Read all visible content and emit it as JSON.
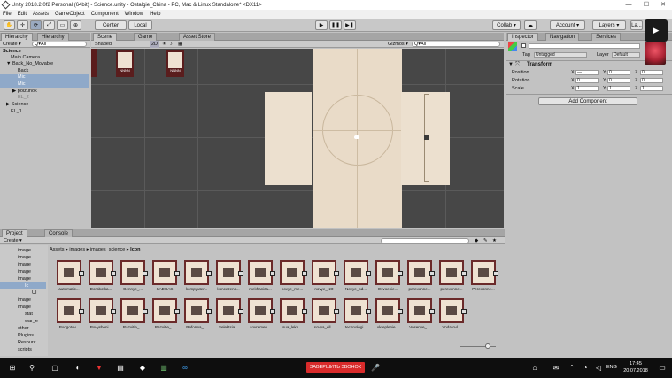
{
  "window": {
    "title": "Unity 2018.2.0f2 Personal (64bit) - Science.unity - Ostalgie_China - PC, Mac & Linux Standalone* <DX11>",
    "min": "—",
    "max": "☐",
    "close": "✕"
  },
  "menu": [
    "File",
    "Edit",
    "Assets",
    "GameObject",
    "Component",
    "Window",
    "Help"
  ],
  "toolbar": {
    "center": "Center",
    "local": "Local",
    "collab": "Collab ▾",
    "account": "Account ▾",
    "layers": "Layers ▾",
    "layout": "La..."
  },
  "hierarchy": {
    "tabs": [
      "Hierarchy",
      "Hierarchy"
    ],
    "create": "Create ▾",
    "search": "Q▾All",
    "items": [
      {
        "label": "Science"
      },
      {
        "label": "Main Camera"
      },
      {
        "label": "▼ Back_No_Movable"
      },
      {
        "label": "Back"
      },
      {
        "label": "Mic"
      },
      {
        "label": "Mic"
      },
      {
        "label": "▶ polzunok"
      },
      {
        "label": "EL_2"
      },
      {
        "label": "▶ Science"
      },
      {
        "label": "EL_1"
      }
    ]
  },
  "scene": {
    "tabs": [
      "Scene",
      "Game",
      "Asset Store"
    ],
    "shaded": "Shaded",
    "mode2d": "2D",
    "gizmos": "Gizmos ▾",
    "search": "Q▾All",
    "thumb_labels": [
      "NNNN",
      "NNNN"
    ]
  },
  "inspector": {
    "tabs": [
      "Inspector",
      "Navigation",
      "Services"
    ],
    "tag_label": "Tag",
    "tag_value": "Untagged",
    "layer_label": "Layer",
    "layer_value": "Default",
    "component": "Transform",
    "rows": [
      {
        "label": "Position",
        "x": "—",
        "y": "0",
        "z": "0"
      },
      {
        "label": "Rotation",
        "x": "0",
        "y": "0",
        "z": "0"
      },
      {
        "label": "Scale",
        "x": "1",
        "y": "1",
        "z": "1"
      }
    ],
    "axis": [
      "X",
      "Y",
      "Z"
    ],
    "add_component": "Add Component"
  },
  "project": {
    "tabs": [
      "Project",
      "Console"
    ],
    "create": "Create ▾",
    "breadcrumb": [
      "Assets",
      "images",
      "images_science",
      "Icon"
    ],
    "tree": [
      "image",
      "image",
      "image",
      "image",
      "image",
      "Ic",
      "UI",
      "image",
      "image",
      "stat",
      "war_e",
      "other",
      "Plugins",
      "Resourc",
      "scripts"
    ],
    "assets_row1": [
      "automatic...",
      "Dorabotka...",
      "Gennye_...",
      "SADGAS",
      "kompyuter...",
      "koncezenc...",
      "mekhaniza...",
      "novye_me...",
      "novye_NO",
      "Novye_od...",
      "Osvoenie...",
      "perexonne...",
      "perexonne...",
      "Perexonne..."
    ],
    "assets_row2": [
      "Podgotov...",
      "Povysheni...",
      "Razvitie_...",
      "Razvitie_...",
      "Reforma_...",
      "Selektsia...",
      "sovremen...",
      "sua_lekh...",
      "sovya_ell...",
      "technologi...",
      "ukreplenie...",
      "Vosenye_...",
      "Vodatovl..."
    ]
  },
  "taskbar": {
    "call_button": "ЗАВЕРШИТЬ ЗВОНОК",
    "lang": "ENG",
    "time": "17:45",
    "date": "20.07.2018"
  }
}
